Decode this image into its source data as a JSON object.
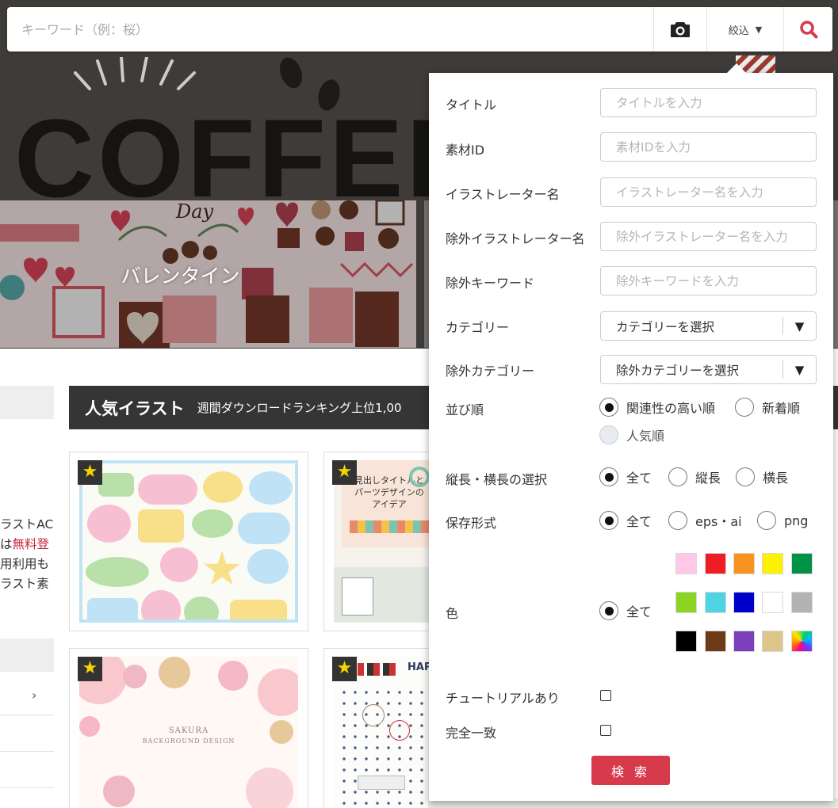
{
  "search": {
    "placeholder": "キーワード（例：桜）",
    "filter_label": "絞込",
    "filter_caret": "▼"
  },
  "hero": {
    "coffee_text": "COFFEE",
    "banner_title": "バレンタイン",
    "banner_day_text": "Day"
  },
  "sidebar": {
    "intro_lines": [
      "ラストAC",
      "は",
      "無料登",
      "用利用も",
      "ラスト素"
    ],
    "chevron": "›"
  },
  "popular": {
    "title": "人気イラスト",
    "subtitle": "週間ダウンロードランキング上位1,00"
  },
  "cards": {
    "star": "★",
    "card2_heading": "見出しタイトルと\nパーツデザインの\nアイデア",
    "card3_title": "SAKURA",
    "card3_subtitle": "BACKGROUND DESIGN",
    "card4_heading": "HAPP"
  },
  "filter_panel": {
    "fields": [
      {
        "label": "タイトル",
        "placeholder": "タイトルを入力"
      },
      {
        "label": "素材ID",
        "placeholder": "素材IDを入力"
      },
      {
        "label": "イラストレーター名",
        "placeholder": "イラストレーター名を入力"
      },
      {
        "label": "除外イラストレーター名",
        "placeholder": "除外イラストレーター名を入力"
      },
      {
        "label": "除外キーワード",
        "placeholder": "除外キーワードを入力"
      }
    ],
    "category": {
      "label": "カテゴリー",
      "value": "カテゴリーを選択"
    },
    "exclude_category": {
      "label": "除外カテゴリー",
      "value": "除外カテゴリーを選択"
    },
    "select_arrow": "▼",
    "sort": {
      "label": "並び順",
      "options": [
        "関連性の高い順",
        "新着順",
        "人気順"
      ],
      "selected": "関連性の高い順"
    },
    "orientation": {
      "label": "縦長・横長の選択",
      "options": [
        "全て",
        "縦長",
        "横長"
      ],
      "selected": "全て"
    },
    "format": {
      "label": "保存形式",
      "options": [
        "全て",
        "eps・ai",
        "png"
      ],
      "selected": "全て"
    },
    "color": {
      "label": "色",
      "option": "全て",
      "swatches": [
        "#ffc8e8",
        "#ee1c24",
        "#f7931e",
        "#fff200",
        "#009245",
        "#8cd623",
        "#4fd4e4",
        "#0000cc",
        "#ffffff",
        "#b3b3b3",
        "#000000",
        "#6b3a16",
        "#7b3fbd",
        "#dcc68a",
        "gradient"
      ]
    },
    "tutorial": {
      "label": "チュートリアルあり",
      "checked": false
    },
    "exact_match": {
      "label": "完全一致",
      "checked": false
    },
    "submit_label": "検 索"
  },
  "colors": {
    "accent": "#d63a4b",
    "header_dark": "#353535",
    "star": "#f5d400"
  }
}
